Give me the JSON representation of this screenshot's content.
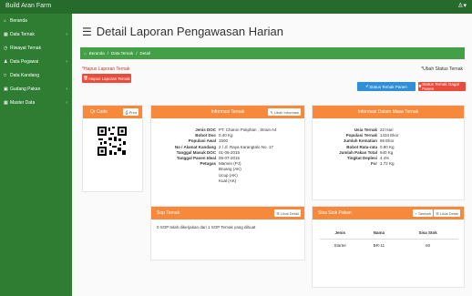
{
  "app": {
    "title": "Build Aran Farm",
    "user_icon": "user-icon"
  },
  "sidebar": {
    "items": [
      {
        "label": "Beranda",
        "icon": "home-icon",
        "chevron": false
      },
      {
        "label": "Data Ternak",
        "icon": "table-icon",
        "chevron": true
      },
      {
        "label": "Riwayat Ternak",
        "icon": "history-icon",
        "chevron": false
      },
      {
        "label": "Data Pegawai",
        "icon": "users-icon",
        "chevron": true
      },
      {
        "label": "Data Kandang",
        "icon": "barn-icon",
        "chevron": false
      },
      {
        "label": "Gudang Pakan",
        "icon": "warehouse-icon",
        "chevron": true
      },
      {
        "label": "Master Data",
        "icon": "grid-icon",
        "chevron": true
      }
    ]
  },
  "page": {
    "title": "Detail Laporan Pengawasan Harian",
    "breadcrumb": [
      "Beranda",
      "/",
      "Data Ternak",
      "/",
      "Detail"
    ],
    "hapus_link": "*Hapus Laporan Ternak",
    "ubah_link": "*Ubah Status Ternak",
    "hapus_button": "Hapus Laporan Ternak",
    "status_panen_button": "Status Ternak Panen",
    "status_gagal_button": "Status Ternak Gagal Panen"
  },
  "qr_panel": {
    "title": "Qr Code",
    "print_button": "Print"
  },
  "info_panel": {
    "title": "Informasi Ternak",
    "button": "Ubah Informasi",
    "rows": [
      {
        "k": "Jenis DOC",
        "v": "PT. Charon Pokphan , Strain A4"
      },
      {
        "k": "Bobot Doc",
        "v": "0.40 Kg"
      },
      {
        "k": "Populasi Awal",
        "v": "1500"
      },
      {
        "k": "No / Alamat Kandang",
        "v": "2 / Jl. Raya Karangtalo No. 17"
      },
      {
        "k": "Tanggal Masuk DOC",
        "v": "01-06-2015"
      },
      {
        "k": "Tanggal Panen Ideal",
        "v": "06-07-2015"
      },
      {
        "k": "Petugas",
        "v": "Mamen (PJ)"
      },
      {
        "k": "",
        "v": "Bruang (AK)"
      },
      {
        "k": "",
        "v": "Ucup (AK)"
      },
      {
        "k": "",
        "v": "Kual (AK)"
      }
    ]
  },
  "masa_panel": {
    "title": "Informasi Dalam Masa Ternak",
    "rows": [
      {
        "k": "Usia Ternak",
        "v": "22 Hari"
      },
      {
        "k": "Populasi Ternak",
        "v": "1434 Ekor"
      },
      {
        "k": "Jumlah Kematian",
        "v": "66 Ekor"
      },
      {
        "k": "Bobot Rata-rata",
        "v": "0.80 Kg"
      },
      {
        "k": "Jumlah Pakan Total",
        "v": "940 Kg"
      },
      {
        "k": "Tingkat Deplesi",
        "v": "4.4%"
      },
      {
        "k": "Fcr",
        "v": "1.72 Kg"
      }
    ]
  },
  "sop_panel": {
    "title": "Sop Ternak",
    "button": "Lihat Detail",
    "text": "0 SOP telah dikerjakan dari 1 SOP Ternak yang dibuat"
  },
  "stok_panel": {
    "title": "Sisa Stok Pakan",
    "tambah_button": "Tambah",
    "lihat_button": "Lihat Detail",
    "columns": [
      "Jenis",
      "Nama",
      "Sisa Stok"
    ],
    "rows": [
      [
        "Starter",
        "BR-11",
        "60"
      ]
    ]
  },
  "colors": {
    "topbar": "#276b2c",
    "sidebar": "#2e7d33",
    "breadcrumb": "#43a047",
    "panel_head": "#f6893b",
    "danger": "#e74c3c",
    "primary": "#2f8fd8"
  }
}
